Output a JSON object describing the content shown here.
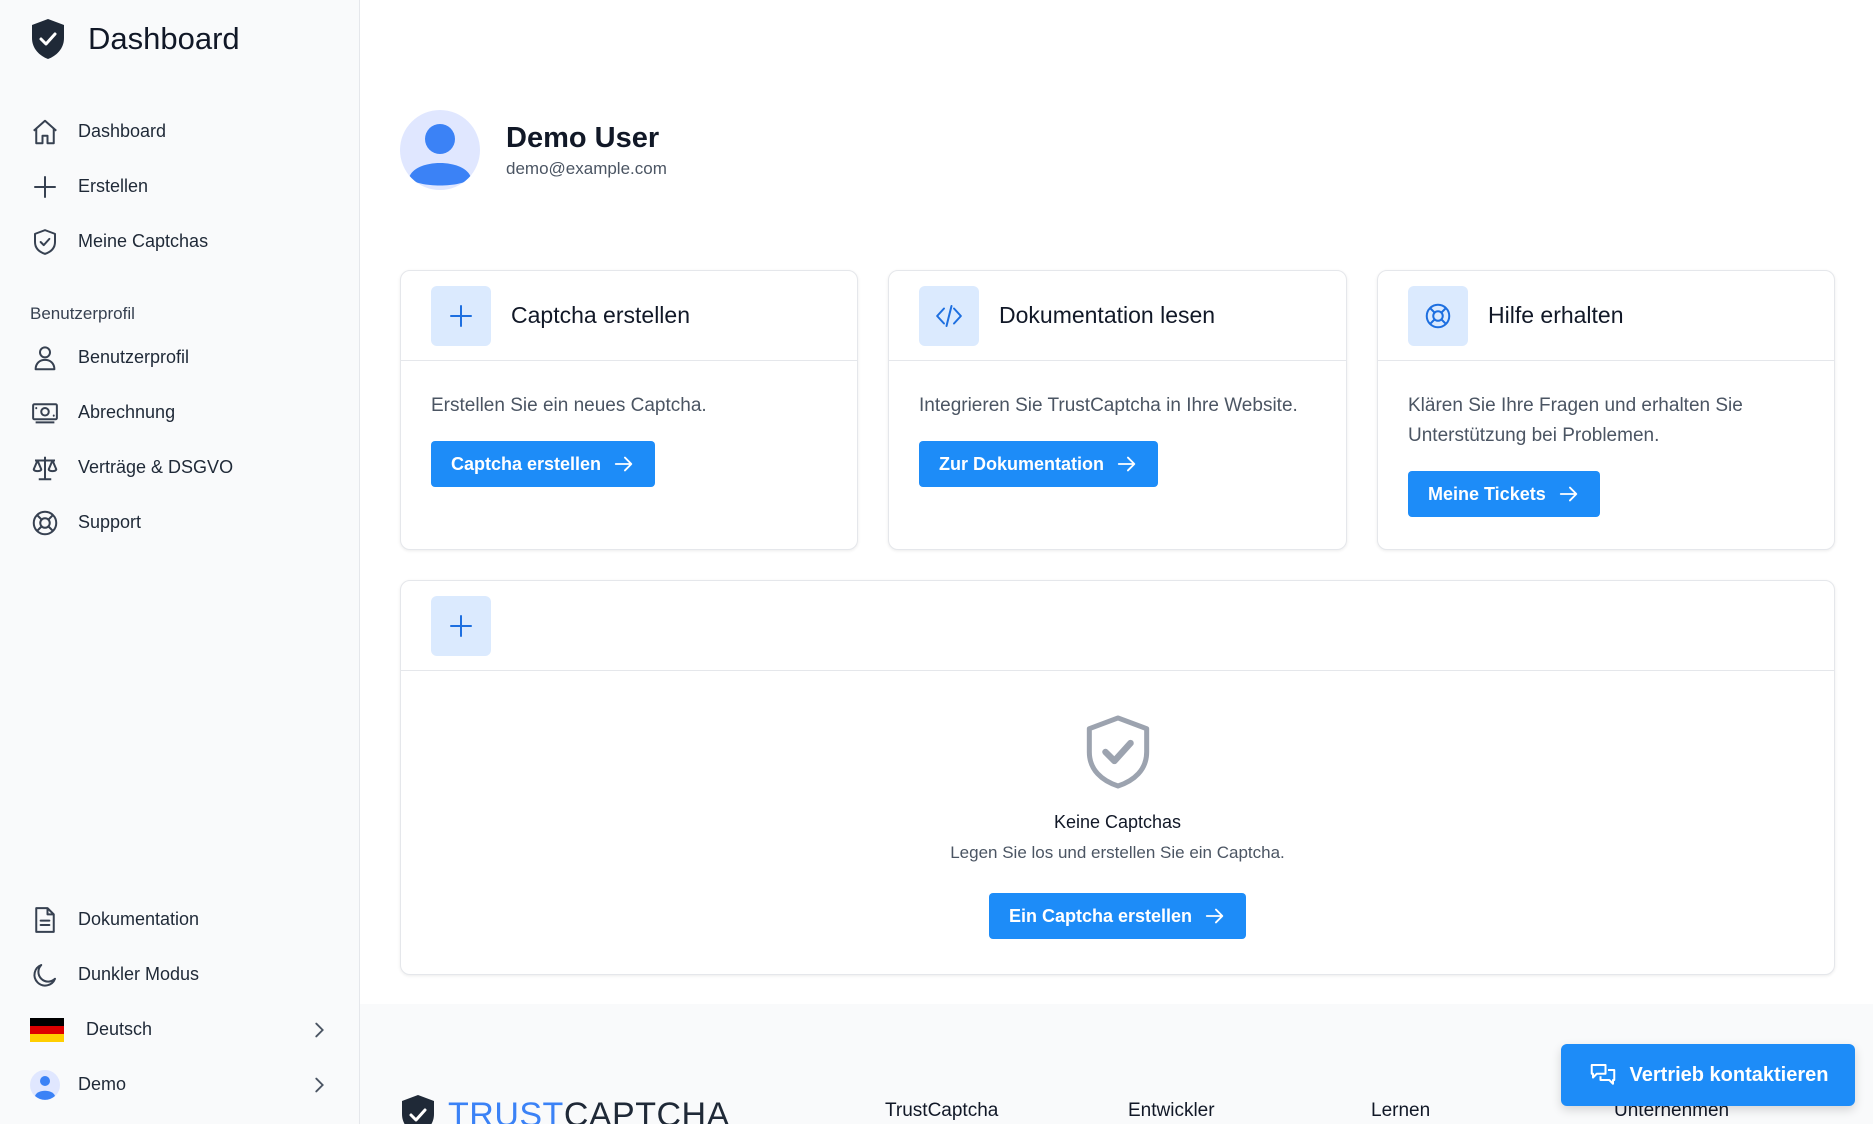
{
  "sidebar": {
    "brand": "Dashboard",
    "nav": [
      {
        "label": "Dashboard",
        "icon": "home-icon"
      },
      {
        "label": "Erstellen",
        "icon": "plus-icon"
      },
      {
        "label": "Meine Captchas",
        "icon": "shield-check-icon"
      }
    ],
    "profile_heading": "Benutzerprofil",
    "profile_nav": [
      {
        "label": "Benutzerprofil",
        "icon": "user-icon"
      },
      {
        "label": "Abrechnung",
        "icon": "billing-icon"
      },
      {
        "label": "Verträge & DSGVO",
        "icon": "scale-icon"
      },
      {
        "label": "Support",
        "icon": "lifebuoy-icon"
      }
    ],
    "bottom": {
      "docs": "Dokumentation",
      "dark_mode": "Dunkler Modus",
      "language": "Deutsch",
      "user": "Demo"
    }
  },
  "profile": {
    "name": "Demo User",
    "email": "demo@example.com"
  },
  "cards": [
    {
      "title": "Captcha erstellen",
      "text": "Erstellen Sie ein neues Captcha.",
      "button": "Captcha erstellen",
      "icon": "plus-icon"
    },
    {
      "title": "Dokumentation lesen",
      "text": "Integrieren Sie TrustCaptcha in Ihre Website.",
      "button": "Zur Dokumentation",
      "icon": "code-icon"
    },
    {
      "title": "Hilfe erhalten",
      "text": "Klären Sie Ihre Fragen und erhalten Sie Unterstützung bei Problemen.",
      "button": "Meine Tickets",
      "icon": "lifebuoy-icon"
    }
  ],
  "captchas": {
    "empty_title": "Keine Captchas",
    "empty_sub": "Legen Sie los und erstellen Sie ein Captcha.",
    "button": "Ein Captcha erstellen"
  },
  "footer": {
    "logo_part1": "TRUST",
    "logo_part2": "CAPTCHA",
    "columns": [
      "TrustCaptcha",
      "Entwickler",
      "Lernen",
      "Unternehmen"
    ],
    "sales_button": "Vertrieb kontaktieren"
  },
  "colors": {
    "accent": "#1d8cf8",
    "icon_bg": "#dbeafe",
    "logo_blue": "#3b82f6",
    "shield_dark": "#1f2937"
  }
}
